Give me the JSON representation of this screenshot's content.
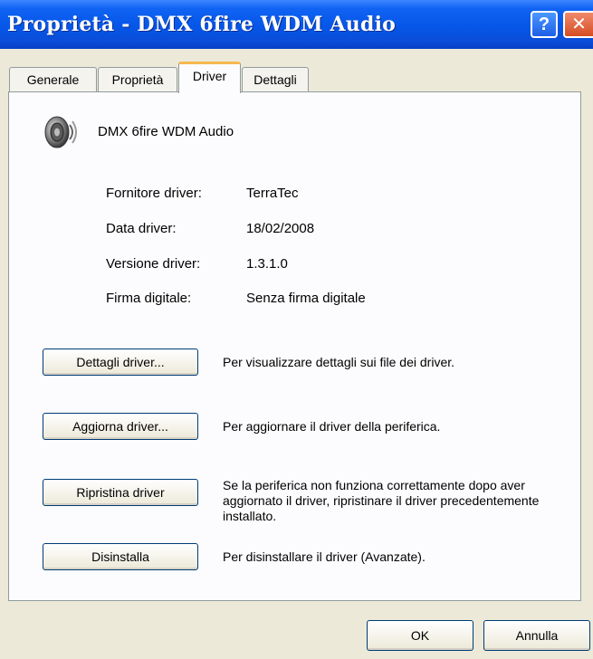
{
  "window": {
    "title": "Proprietà - DMX 6fire WDM Audio",
    "help_label": "?",
    "close_label": "✕"
  },
  "tabs": [
    {
      "label": "Generale",
      "active": false
    },
    {
      "label": "Proprietà",
      "active": false
    },
    {
      "label": "Driver",
      "active": true
    },
    {
      "label": "Dettagli",
      "active": false
    }
  ],
  "device": {
    "icon": "speaker-icon",
    "name": "DMX 6fire WDM Audio"
  },
  "info": [
    {
      "label": "Fornitore driver:",
      "value": "TerraTec"
    },
    {
      "label": "Data driver:",
      "value": "18/02/2008"
    },
    {
      "label": "Versione driver:",
      "value": "1.3.1.0"
    },
    {
      "label": "Firma digitale:",
      "value": "Senza firma digitale"
    }
  ],
  "actions": [
    {
      "label": "Dettagli driver...",
      "description": "Per visualizzare dettagli sui file dei driver."
    },
    {
      "label": "Aggiorna driver...",
      "description": "Per aggiornare il driver della periferica."
    },
    {
      "label": "Ripristina driver",
      "description": "Se la periferica non funziona correttamente dopo aver aggiornato il driver, ripristinare il driver precedentemente installato."
    },
    {
      "label": "Disinstalla",
      "description": "Per disinstallare il driver (Avanzate)."
    }
  ],
  "footer": {
    "ok_label": "OK",
    "cancel_label": "Annulla"
  }
}
